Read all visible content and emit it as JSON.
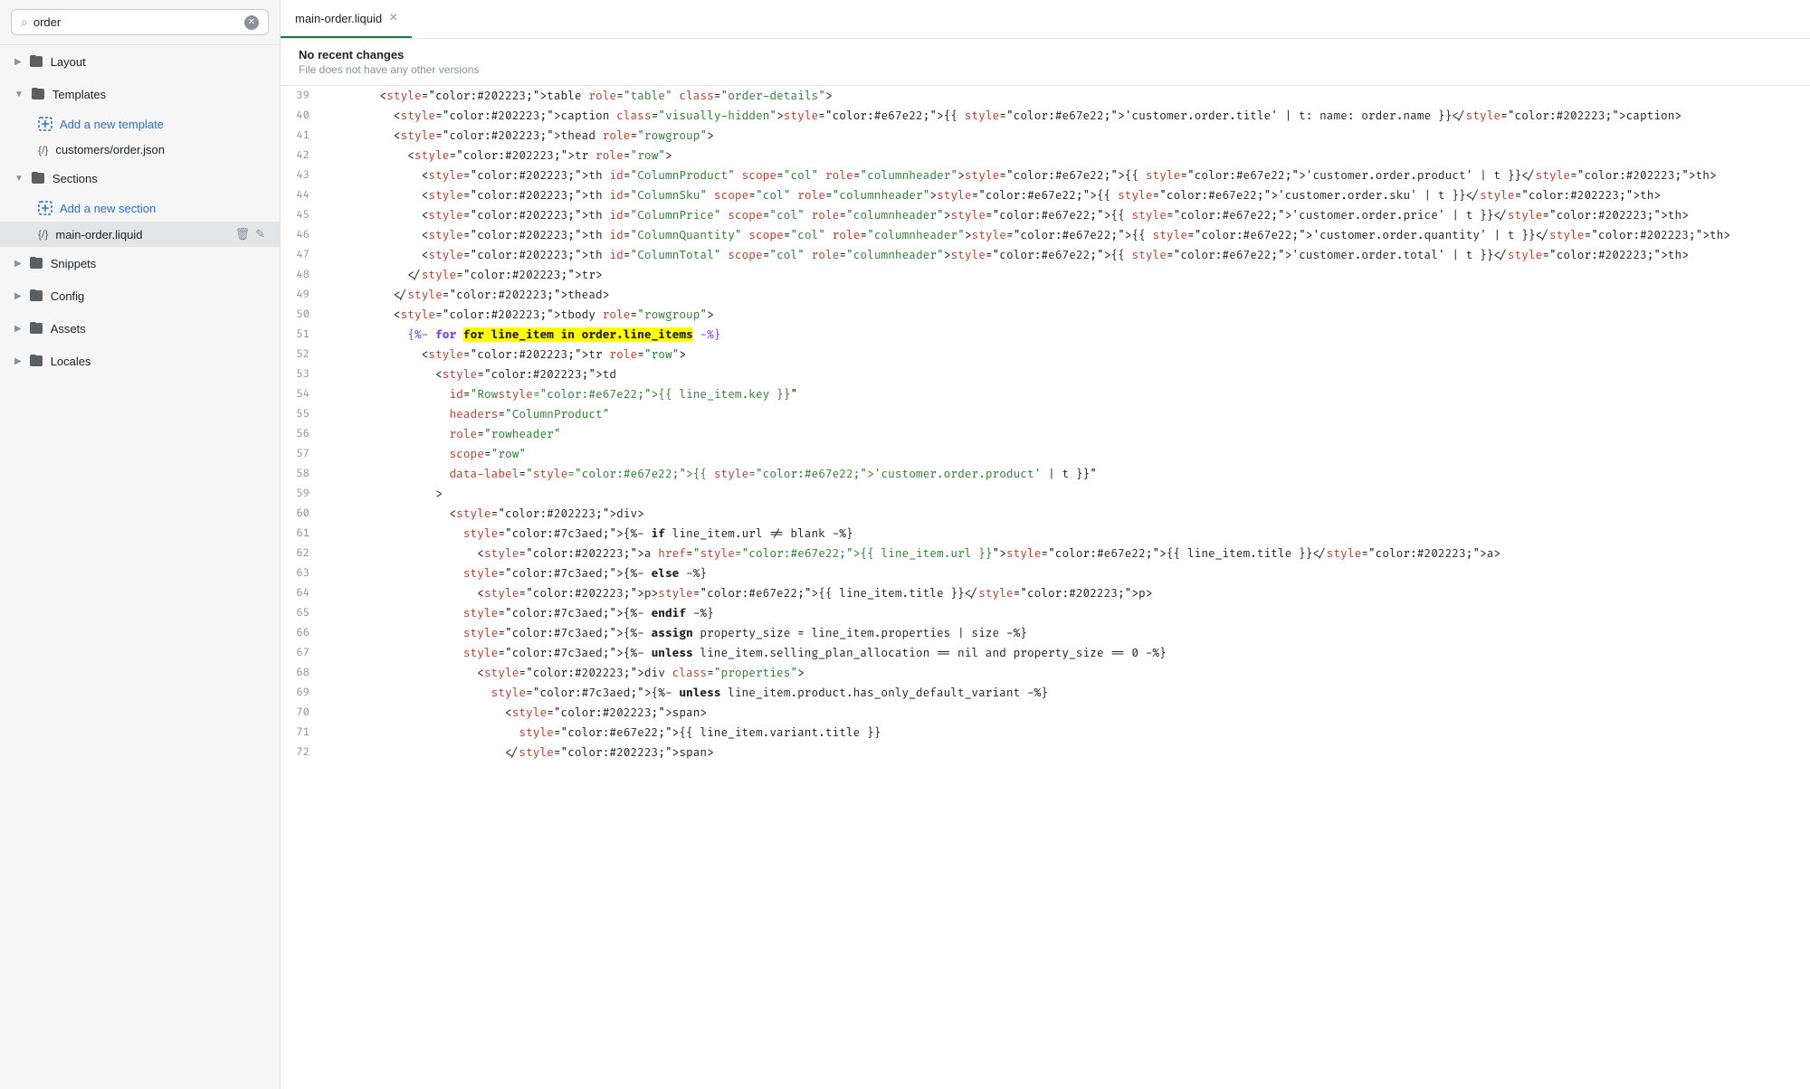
{
  "search": {
    "placeholder": "order",
    "value": "order"
  },
  "sidebar": {
    "sections": [
      {
        "id": "layout",
        "label": "Layout",
        "type": "folder",
        "collapsed": true,
        "children": []
      },
      {
        "id": "templates",
        "label": "Templates",
        "type": "folder",
        "collapsed": false,
        "children": [
          {
            "id": "add-template",
            "label": "Add a new template",
            "type": "add"
          },
          {
            "id": "customers-order",
            "label": "customers/order.json",
            "type": "file"
          }
        ]
      },
      {
        "id": "sections",
        "label": "Sections",
        "type": "folder",
        "collapsed": false,
        "children": [
          {
            "id": "add-section",
            "label": "Add a new section",
            "type": "add"
          },
          {
            "id": "main-order-liquid",
            "label": "main-order.liquid",
            "type": "file",
            "active": true
          }
        ]
      },
      {
        "id": "snippets",
        "label": "Snippets",
        "type": "folder",
        "collapsed": true,
        "children": []
      },
      {
        "id": "config",
        "label": "Config",
        "type": "folder",
        "collapsed": true,
        "children": []
      },
      {
        "id": "assets",
        "label": "Assets",
        "type": "folder",
        "collapsed": true,
        "children": []
      },
      {
        "id": "locales",
        "label": "Locales",
        "type": "folder",
        "collapsed": true,
        "children": []
      }
    ]
  },
  "editor": {
    "tab_label": "main-order.liquid",
    "tab_close": "×",
    "info_title": "No recent changes",
    "info_sub": "File does not have any other versions"
  },
  "code_lines": [
    {
      "num": 39,
      "content": "        <table role=\"table\" class=\"order-details\">"
    },
    {
      "num": 40,
      "content": "          <caption class=\"visually-hidden\">{{ 'customer.order.title' | t: name: order.name }}</caption>"
    },
    {
      "num": 41,
      "content": "          <thead role=\"rowgroup\">"
    },
    {
      "num": 42,
      "content": "            <tr role=\"row\">"
    },
    {
      "num": 43,
      "content": "              <th id=\"ColumnProduct\" scope=\"col\" role=\"columnheader\">{{ 'customer.order.product' | t }}</th>"
    },
    {
      "num": 44,
      "content": "              <th id=\"ColumnSku\" scope=\"col\" role=\"columnheader\">{{ 'customer.order.sku' | t }}</th>"
    },
    {
      "num": 45,
      "content": "              <th id=\"ColumnPrice\" scope=\"col\" role=\"columnheader\">{{ 'customer.order.price' | t }}</th>"
    },
    {
      "num": 46,
      "content": "              <th id=\"ColumnQuantity\" scope=\"col\" role=\"columnheader\">{{ 'customer.order.quantity' | t }}</th>"
    },
    {
      "num": 47,
      "content": "              <th id=\"ColumnTotal\" scope=\"col\" role=\"columnheader\">{{ 'customer.order.total' | t }}</th>"
    },
    {
      "num": 48,
      "content": "            </tr>"
    },
    {
      "num": 49,
      "content": "          </thead>"
    },
    {
      "num": 50,
      "content": "          <tbody role=\"rowgroup\">"
    },
    {
      "num": 51,
      "content": "            {%- for line_item in order.line_items -%}"
    },
    {
      "num": 52,
      "content": "              <tr role=\"row\">"
    },
    {
      "num": 53,
      "content": "                <td"
    },
    {
      "num": 54,
      "content": "                  id=\"Row{{ line_item.key }}\""
    },
    {
      "num": 55,
      "content": "                  headers=\"ColumnProduct\""
    },
    {
      "num": 56,
      "content": "                  role=\"rowheader\""
    },
    {
      "num": 57,
      "content": "                  scope=\"row\""
    },
    {
      "num": 58,
      "content": "                  data-label=\"{{ 'customer.order.product' | t }}\""
    },
    {
      "num": 59,
      "content": "                >"
    },
    {
      "num": 60,
      "content": "                  <div>"
    },
    {
      "num": 61,
      "content": "                    {%- if line_item.url != blank -%}"
    },
    {
      "num": 62,
      "content": "                      <a href=\"{{ line_item.url }}\">{{ line_item.title }}</a>"
    },
    {
      "num": 63,
      "content": "                    {%- else -%}"
    },
    {
      "num": 64,
      "content": "                      <p>{{ line_item.title }}</p>"
    },
    {
      "num": 65,
      "content": "                    {%- endif -%}"
    },
    {
      "num": 66,
      "content": "                    {%- assign property_size = line_item.properties | size -%}"
    },
    {
      "num": 67,
      "content": "                    {%- unless line_item.selling_plan_allocation == nil and property_size == 0 -%}"
    },
    {
      "num": 68,
      "content": "                      <div class=\"properties\">"
    },
    {
      "num": 69,
      "content": "                        {%- unless line_item.product.has_only_default_variant -%}"
    },
    {
      "num": 70,
      "content": "                          <span>"
    },
    {
      "num": 71,
      "content": "                            {{ line_item.variant.title }}"
    },
    {
      "num": 72,
      "content": "                          </span>"
    }
  ]
}
